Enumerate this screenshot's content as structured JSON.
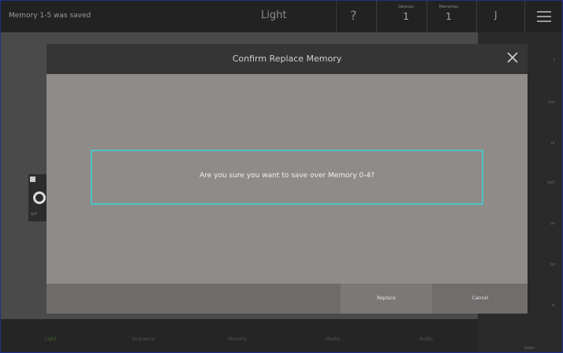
{
  "topbar": {
    "status": "Memory 1-5 was saved",
    "title": "Light",
    "help": "?",
    "devices_label": "Devices",
    "devices_count": "1",
    "memories_label": "Memories",
    "memories_count": "1",
    "j_label": "J"
  },
  "modal": {
    "title": "Confirm Replace Memory",
    "message": "Are you sure you want to save over Memory 0-4?",
    "replace_label": "Replace",
    "cancel_label": "Cancel"
  },
  "background": {
    "widget_caption": "GLP"
  },
  "bottom_nav": {
    "tabs": [
      "Light",
      "Sequence",
      "Memory",
      "Media",
      "Audio"
    ],
    "active": "Light"
  },
  "right_panel": {
    "labels": [
      "s",
      "ove",
      "ur",
      "tect",
      "on",
      "on",
      "ın"
    ],
    "bottom_label": "Gobo"
  },
  "colors": {
    "accent_border": "#4cc4c4",
    "modal_body": "#8f8b89",
    "header_bg": "#222222"
  }
}
